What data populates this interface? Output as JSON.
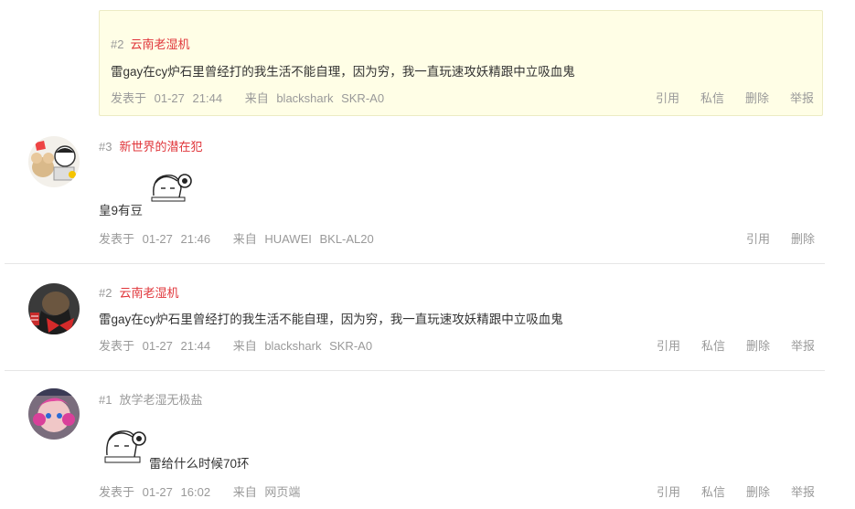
{
  "quote": {
    "floor": "#2",
    "author": "云南老湿机",
    "content": "雷gay在cy炉石里曾经打的我生活不能自理，因为穷，我一直玩速攻妖精跟中立吸血鬼",
    "meta": {
      "posted_label": "发表于",
      "date": "01-27",
      "time": "21:44",
      "from_label": "来自",
      "device": "blackshark",
      "model": "SKR-A0"
    },
    "actions": [
      "引用",
      "私信",
      "删除",
      "举报"
    ]
  },
  "posts": [
    {
      "floor": "#3",
      "author": "新世界的潜在犯",
      "content": "皇9有豆",
      "meta": {
        "posted_label": "发表于",
        "date": "01-27",
        "time": "21:46",
        "from_label": "来自",
        "device": "HUAWEI",
        "model": "BKL-AL20"
      },
      "actions": [
        "引用",
        "删除"
      ]
    },
    {
      "floor": "#2",
      "author": "云南老湿机",
      "content": "雷gay在cy炉石里曾经打的我生活不能自理，因为穷，我一直玩速攻妖精跟中立吸血鬼",
      "meta": {
        "posted_label": "发表于",
        "date": "01-27",
        "time": "21:44",
        "from_label": "来自",
        "device": "blackshark",
        "model": "SKR-A0"
      },
      "actions": [
        "引用",
        "私信",
        "删除",
        "举报"
      ]
    },
    {
      "floor": "#1",
      "author": "放学老湿无极盐",
      "content": "雷给什么时候70环",
      "meta": {
        "posted_label": "发表于",
        "date": "01-27",
        "time": "16:02",
        "from_label": "来自",
        "device": "网页端",
        "model": ""
      },
      "actions": [
        "引用",
        "私信",
        "删除",
        "举报"
      ]
    }
  ]
}
